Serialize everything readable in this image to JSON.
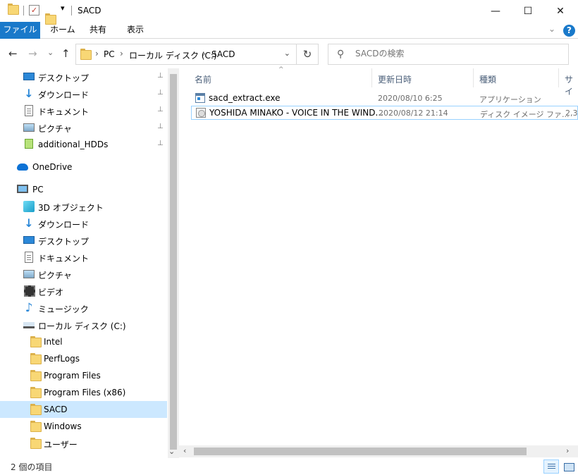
{
  "window": {
    "title": "SACD",
    "controls": {
      "minimize": "—",
      "maximize": "☐",
      "close": "✕"
    }
  },
  "ribbon": {
    "tabs": [
      "ファイル",
      "ホーム",
      "共有",
      "表示"
    ],
    "expand_glyph": "⌄",
    "help_label": "?"
  },
  "address": {
    "back": "←",
    "forward": "→",
    "recent": "⌄",
    "up": "↑",
    "breadcrumbs": [
      "PC",
      "ローカル ディスク (C:)",
      "SACD"
    ],
    "separator": "›",
    "dropdown": "⌄",
    "refresh": "↻"
  },
  "search": {
    "placeholder": "SACDの検索",
    "icon": "search-icon"
  },
  "navpane": {
    "quick_access": [
      {
        "label": "デスクトップ",
        "icon": "desktop-icon",
        "pinned": true
      },
      {
        "label": "ダウンロード",
        "icon": "download-icon",
        "pinned": true
      },
      {
        "label": "ドキュメント",
        "icon": "document-icon",
        "pinned": true
      },
      {
        "label": "ピクチャ",
        "icon": "picture-icon",
        "pinned": true
      },
      {
        "label": "additional_HDDs",
        "icon": "hdd-icon",
        "pinned": true
      }
    ],
    "onedrive": "OneDrive",
    "pc": "PC",
    "pc_items": [
      {
        "label": "3D オブジェクト",
        "icon": "3d-objects-icon"
      },
      {
        "label": "ダウンロード",
        "icon": "download-icon"
      },
      {
        "label": "デスクトップ",
        "icon": "desktop-icon"
      },
      {
        "label": "ドキュメント",
        "icon": "document-icon"
      },
      {
        "label": "ピクチャ",
        "icon": "picture-icon"
      },
      {
        "label": "ビデオ",
        "icon": "video-icon"
      },
      {
        "label": "ミュージック",
        "icon": "music-icon"
      },
      {
        "label": "ローカル ディスク (C:)",
        "icon": "drive-icon"
      }
    ],
    "drive_folders": [
      "Intel",
      "PerfLogs",
      "Program Files",
      "Program Files (x86)",
      "SACD",
      "Windows",
      "ユーザー"
    ],
    "selected": "SACD",
    "pin_glyph": "📌"
  },
  "columns": [
    "名前",
    "更新日時",
    "種類",
    "サイ"
  ],
  "files": [
    {
      "name": "sacd_extract.exe",
      "modified": "2020/08/10 6:25",
      "type": "アプリケーション",
      "size": "",
      "icon": "exe-icon"
    },
    {
      "name": "YOSHIDA MINAKO - VOICE IN THE WIND...",
      "modified": "2020/08/12 21:14",
      "type": "ディスク イメージ ファ...",
      "size": "2,3",
      "icon": "disc-image-icon"
    }
  ],
  "status": {
    "item_count": "2 個の項目"
  },
  "colors": {
    "accent": "#1979ca",
    "selection": "#cce8ff",
    "folder": "#f8d775"
  }
}
